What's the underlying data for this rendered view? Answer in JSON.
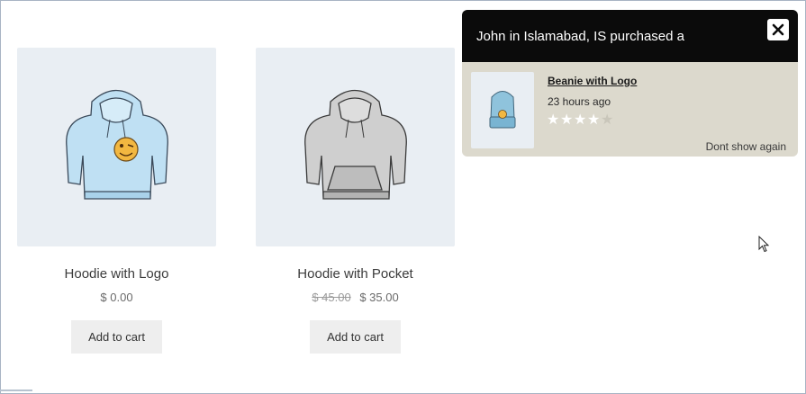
{
  "products": [
    {
      "name": "Hoodie with Logo",
      "price": "$ 0.00",
      "old_price": "",
      "button": "Add to cart",
      "color": "#bfe0f3"
    },
    {
      "name": "Hoodie with Pocket",
      "price": "$ 35.00",
      "old_price": "$ 45.00",
      "button": "Add to cart",
      "color": "#c9c9c9"
    }
  ],
  "popup": {
    "headline": "John in Islamabad, IS purchased a",
    "close_icon": "close-icon",
    "product_name": "Beanie with Logo",
    "time_ago": "23 hours ago",
    "rating": 4,
    "rating_max": 5,
    "dismiss_label": "Dont show again",
    "header_color": "#0b0b0b",
    "body_color": "#dcd9cd"
  }
}
